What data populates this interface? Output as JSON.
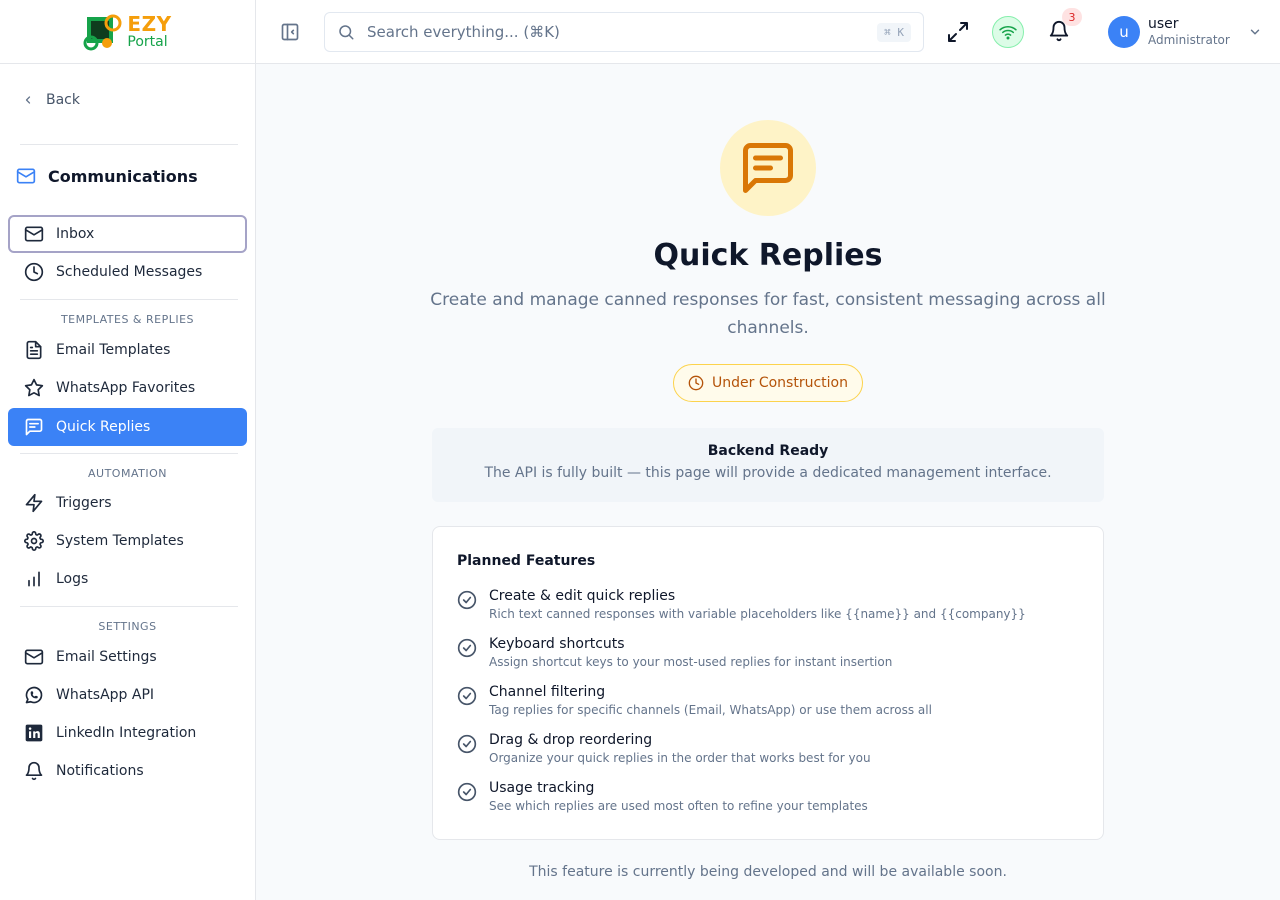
{
  "brand": {
    "name_top": "EZY",
    "name_bottom": "Portal"
  },
  "sidebar": {
    "back_label": "Back",
    "section_title": "Communications",
    "items": [
      {
        "label": "Inbox",
        "icon": "mail-icon"
      },
      {
        "label": "Scheduled Messages",
        "icon": "clock-icon"
      },
      {
        "label": "Email Templates",
        "icon": "file-text-icon"
      },
      {
        "label": "WhatsApp Favorites",
        "icon": "star-icon"
      },
      {
        "label": "Quick Replies",
        "icon": "message-square-icon",
        "active": true
      },
      {
        "label": "Triggers",
        "icon": "zap-icon"
      },
      {
        "label": "System Templates",
        "icon": "gear-icon"
      },
      {
        "label": "Logs",
        "icon": "bar-chart-icon"
      },
      {
        "label": "Email Settings",
        "icon": "mail-icon"
      },
      {
        "label": "WhatsApp API",
        "icon": "whatsapp-icon"
      },
      {
        "label": "LinkedIn Integration",
        "icon": "linkedin-icon"
      },
      {
        "label": "Notifications",
        "icon": "bell-icon"
      }
    ],
    "groups": {
      "templates": "TEMPLATES & REPLIES",
      "automation": "AUTOMATION",
      "settings": "SETTINGS"
    }
  },
  "header": {
    "search_placeholder": "Search everything... (⌘K)",
    "search_shortcut": "⌘ K",
    "notification_count": "3",
    "user": {
      "initial": "u",
      "name": "user",
      "role": "Administrator"
    }
  },
  "main": {
    "title": "Quick Replies",
    "subtitle": "Create and manage canned responses for fast, consistent messaging across all channels.",
    "status": "Under Construction",
    "ready_title": "Backend Ready",
    "ready_desc": "The API is fully built — this page will provide a dedicated management interface.",
    "features_title": "Planned Features",
    "features": [
      {
        "name": "Create & edit quick replies",
        "desc": "Rich text canned responses with variable placeholders like {{name}} and {{company}}"
      },
      {
        "name": "Keyboard shortcuts",
        "desc": "Assign shortcut keys to your most-used replies for instant insertion"
      },
      {
        "name": "Channel filtering",
        "desc": "Tag replies for specific channels (Email, WhatsApp) or use them across all"
      },
      {
        "name": "Drag & drop reordering",
        "desc": "Organize your quick replies in the order that works best for you"
      },
      {
        "name": "Usage tracking",
        "desc": "See which replies are used most often to refine your templates"
      }
    ],
    "footer_note": "This feature is currently being developed and will be available soon."
  },
  "colors": {
    "accent": "#3b82f6",
    "warning": "#d97706",
    "success": "#16a34a"
  }
}
